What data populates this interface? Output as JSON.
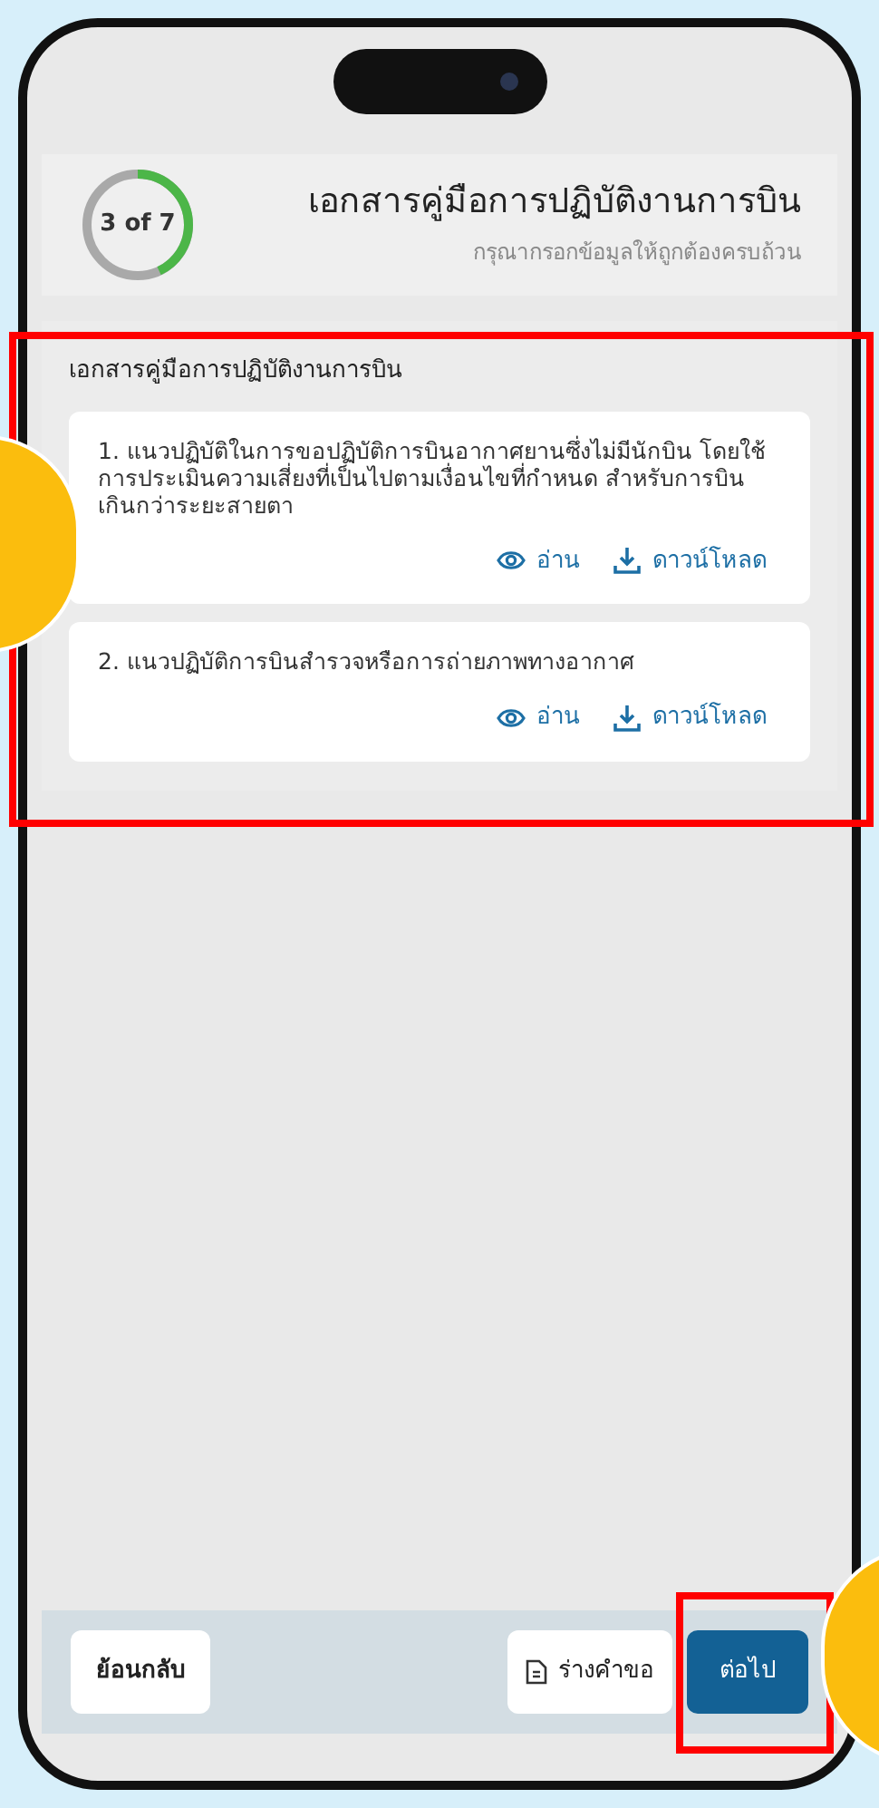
{
  "header": {
    "progress": {
      "label": "3 of 7",
      "level": 0.43
    },
    "title": "เอกสารคู่มือการปฏิบัติงานการบิน",
    "subtitle": "กรุณากรอกข้อมูลให้ถูกต้องครบถ้วน"
  },
  "section": {
    "title": "เอกสารคู่มือการปฏิบัติงานการบิน",
    "documents": [
      {
        "title": "1. แนวปฏิบัติในการขอปฏิบัติการบินอากาศยานซึ่งไม่มีนักบิน โดยใช้การประเมินความเสี่ยงที่เป็นไปตามเงื่อนไขที่กำหนด สำหรับการบินเกินกว่าระยะสายตา",
        "read": "อ่าน",
        "download": "ดาวน์โหลด"
      },
      {
        "title": "2. แนวปฏิบัติการบินสำรวจหรือการถ่ายภาพทางอากาศ",
        "read": "อ่าน",
        "download": "ดาวน์โหลด"
      }
    ]
  },
  "footer": {
    "back": "ย้อนกลับ",
    "draft": "ร่างคำขอ",
    "next": "ต่อไป"
  }
}
